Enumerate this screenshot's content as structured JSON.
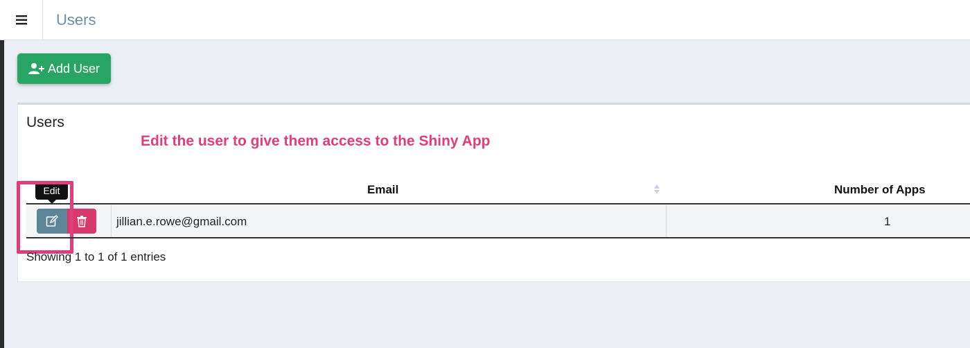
{
  "header": {
    "title": "Users"
  },
  "toolbar": {
    "add_user_label": "Add User"
  },
  "card": {
    "title": "Users",
    "annotation": "Edit the user to give them access to the Shiny App"
  },
  "table": {
    "columns": [
      "",
      "Email",
      "Number of Apps"
    ],
    "rows": [
      {
        "email": "jillian.e.rowe@gmail.com",
        "apps": "1"
      }
    ],
    "tooltip": "Edit",
    "info": "Showing 1 to 1 of 1 entries"
  },
  "colors": {
    "accent_green": "#28a563",
    "edit_button": "#5d8599",
    "delete_button": "#d9386c",
    "annotation": "#e23d7a"
  },
  "icons": {
    "menu": "hamburger-icon",
    "add_user": "user-plus-icon",
    "edit": "edit-icon",
    "delete": "trash-icon",
    "sort": "sort-icon"
  }
}
